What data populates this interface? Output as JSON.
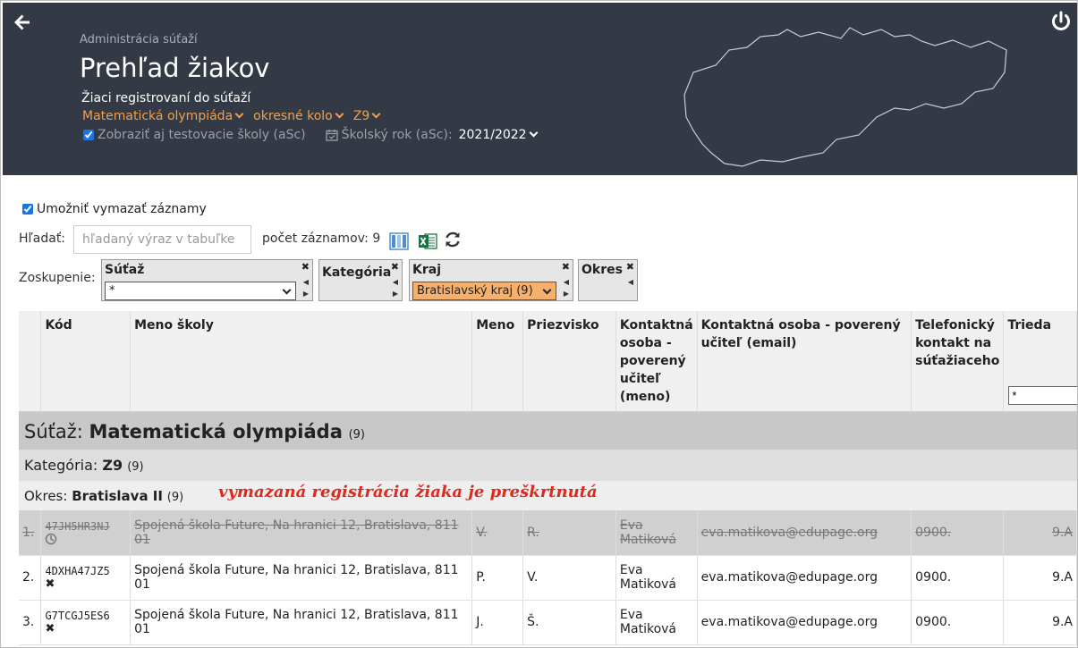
{
  "header": {
    "breadcrumb": "Administrácia súťaží",
    "title": "Prehľad žiakov",
    "subtitle": "Žiaci registrovaní do súťaží",
    "competition": "Matematická olympiáda",
    "round": "okresné kolo",
    "category": "Z9",
    "show_test_schools": "Zobraziť aj testovacie školy (aSc)",
    "school_year_label": "Školský rok (aSc):",
    "school_year": "2021/2022"
  },
  "controls": {
    "allow_delete": "Umožniť vymazať záznamy",
    "search_label": "Hľadať:",
    "search_placeholder": "hľadaný výraz v tabuľke",
    "count_label": "počet záznamov: 9"
  },
  "grouping": {
    "label": "Zoskupenie:",
    "boxes": [
      {
        "title": "Súťaž",
        "value": "*"
      },
      {
        "title": "Kategória"
      },
      {
        "title": "Kraj",
        "value": "Bratislavský kraj (9)"
      },
      {
        "title": "Okres"
      }
    ]
  },
  "table": {
    "columns": [
      "",
      "Kód",
      "Meno školy",
      "Meno",
      "Priezvisko",
      "Kontaktná osoba - poverený učiteľ (meno)",
      "Kontaktná osoba - poverený učiteľ (email)",
      "Telefonický kontakt na súťažiaceho",
      "Trieda"
    ],
    "trieda_filter": "*",
    "group1": {
      "prefix": "Súťaž:",
      "name": "Matematická olympiáda",
      "count": "(9)"
    },
    "group2": {
      "prefix": "Kategória:",
      "name": "Z9",
      "count": "(9)"
    },
    "group3": {
      "prefix": "Okres:",
      "name": "Bratislava II",
      "count": "(9)"
    },
    "rows": [
      {
        "num": "1.",
        "code": "47JH5HR3NJ",
        "school": "Spojená škola Future, Na hranici 12, Bratislava, 811 01",
        "first": "V.",
        "last": "R.",
        "teacher": "Eva Matiková",
        "email": "eva.matikova@edupage.org",
        "phone": "0900.",
        "class": "9.A"
      },
      {
        "num": "2.",
        "code": "4DXHA47JZ5",
        "school": "Spojená škola Future, Na hranici 12, Bratislava, 811 01",
        "first": "P.",
        "last": "V.",
        "teacher": "Eva Matiková",
        "email": "eva.matikova@edupage.org",
        "phone": "0900.",
        "class": "9.A"
      },
      {
        "num": "3.",
        "code": "G7TCGJ5ES6",
        "school": "Spojená škola Future, Na hranici 12, Bratislava, 811 01",
        "first": "J.",
        "last": "Š.",
        "teacher": "Eva Matiková",
        "email": "eva.matikova@edupage.org",
        "phone": "0900.",
        "class": "9.A"
      }
    ]
  },
  "annotation": "vymazaná registrácia žiaka je preškrtnutá"
}
